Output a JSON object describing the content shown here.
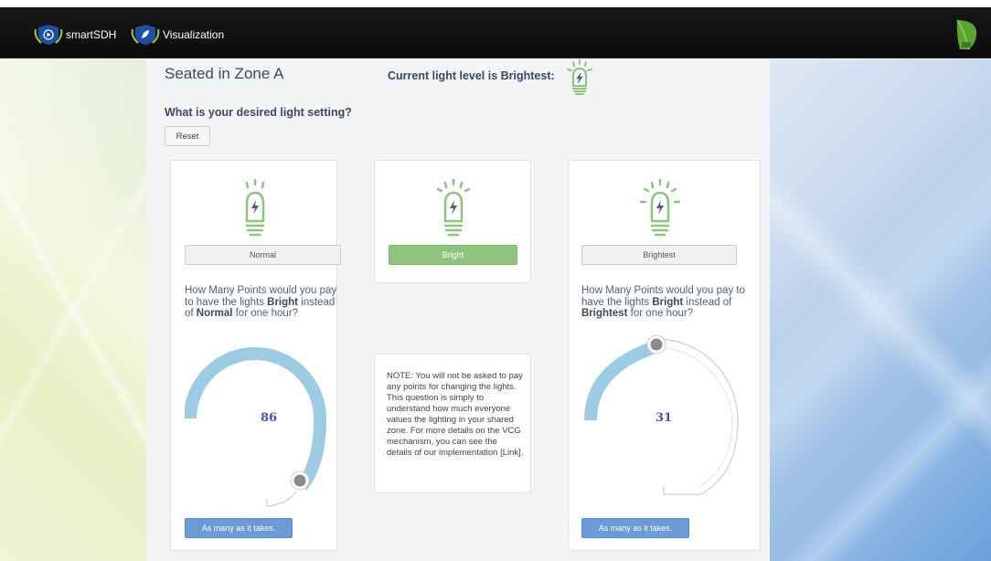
{
  "nav": {
    "items": [
      {
        "label": "smartSDH",
        "icon": "play-icon"
      },
      {
        "label": "Visualization",
        "icon": "leaf-icon"
      }
    ],
    "logo": "sdh-leaf-logo"
  },
  "header": {
    "title": "Seated in Zone A",
    "light_status": "Current light level is Brightest:",
    "question": "What is your desired light setting?",
    "reset_label": "Reset"
  },
  "options": [
    {
      "label": "Normal",
      "active": false
    },
    {
      "label": "Bright",
      "active": true
    },
    {
      "label": "Brightest",
      "active": false
    }
  ],
  "left_panel": {
    "q_pre": "How Many Points would you pay to have the lights ",
    "q_target": "Bright",
    "q_mid": " instead of ",
    "q_from": "Normal",
    "q_post": " for one hour?",
    "value": "86",
    "button_label": "As many as it takes."
  },
  "right_panel": {
    "q_pre": "How Many Points would you pay to have the lights ",
    "q_target": "Bright",
    "q_mid": " instead of ",
    "q_from": "Brightest",
    "q_post": " for one hour?",
    "value": "31",
    "button_label": "As many as it takes."
  },
  "note": "NOTE: You will not be asked to pay any points for changing the lights. This question is simply to understand how much everyone values the lighting in your shared zone. For more details on the VCG mechanism, you can see the details of our implementation [Link].",
  "colors": {
    "navbar": "#111111",
    "bulb_green": "#8cc57b",
    "dial_fill": "#9ccbe4",
    "button_blue": "#6b9bd6",
    "text_dark": "#3b4a62"
  }
}
